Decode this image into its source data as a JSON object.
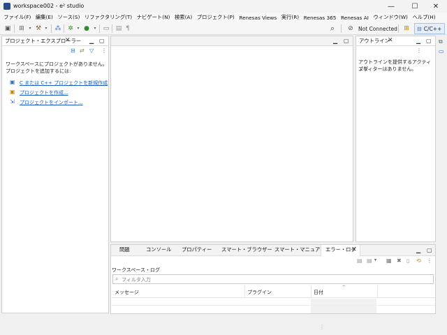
{
  "window": {
    "title": "workspace002 - e² studio",
    "controls": {
      "minimize": "—",
      "maximize": "☐",
      "close": "✕"
    }
  },
  "menubar": {
    "items": [
      "ファイル(F)",
      "編集(E)",
      "ソース(S)",
      "リファクタリング(T)",
      "ナビゲート(N)",
      "検索(A)",
      "プロジェクト(P)",
      "Renesas Views",
      "実行(R)",
      "Renesas 365",
      "Renesas AI",
      "ウィンドウ(W)",
      "ヘルプ(H)"
    ]
  },
  "toolbar": {
    "connection_status": "Not Connected",
    "perspective_label": "C/C++"
  },
  "project_explorer": {
    "tab_label": "プロジェクト・エクスプローラー",
    "empty_message_line1": "ワークスペースにプロジェクトがありません。",
    "empty_message_line2": "プロジェクトを追加するには:",
    "links": [
      "C または C++ プロジェクトを新規作成",
      "プロジェクトを作成...",
      "プロジェクトをインポート..."
    ]
  },
  "outline": {
    "tab_label": "アウトライン",
    "message_line1": "アウトラインを提供するアクティブな",
    "message_line2": "エディターはありません。"
  },
  "bottom_panel": {
    "tabs": [
      "問題",
      "コンソール",
      "プロパティー",
      "スマート・ブラウザー",
      "スマート・マニュアル",
      "エラー・ログ"
    ],
    "active_tab": "エラー・ログ",
    "workspace_log_label": "ワークスペース・ログ",
    "filter_placeholder": "フィルタ入力",
    "columns": [
      "メッセージ",
      "プラグイン",
      "日付"
    ]
  },
  "colors": {
    "link": "#1a5dbf",
    "brand": "#2c4a8a",
    "active_perspective_bg": "#e4eefb"
  }
}
